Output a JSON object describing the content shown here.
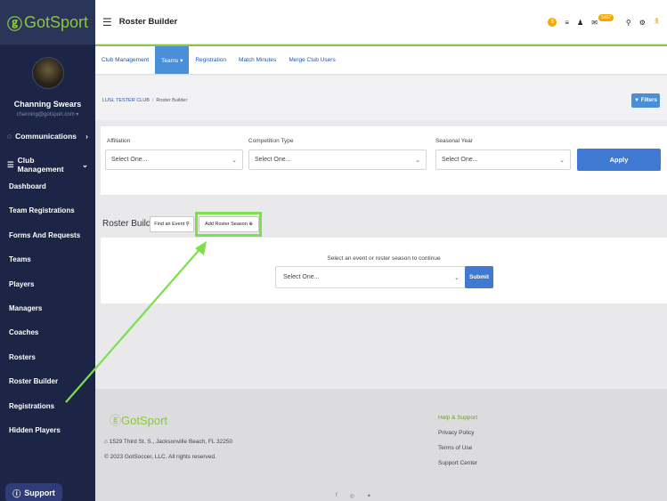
{
  "brand": {
    "name": "GotSport"
  },
  "user": {
    "name": "Channing Swears",
    "email": "channing@gotsport.com ▾"
  },
  "sidebar": {
    "communications": "Communications",
    "club_management": "Club Management",
    "items": [
      {
        "label": "Dashboard"
      },
      {
        "label": "Team Registrations"
      },
      {
        "label": "Forms And Requests"
      },
      {
        "label": "Teams"
      },
      {
        "label": "Players"
      },
      {
        "label": "Managers"
      },
      {
        "label": "Coaches"
      },
      {
        "label": "Rosters"
      },
      {
        "label": "Roster Builder"
      },
      {
        "label": "Registrations"
      },
      {
        "label": "Hidden Players"
      }
    ],
    "support_label": "Support"
  },
  "header": {
    "title": "Roster Builder",
    "notification_count": "5467"
  },
  "tabs": [
    {
      "label": "Club Management"
    },
    {
      "label": "Teams ▾"
    },
    {
      "label": "Registration"
    },
    {
      "label": "Match Minutes"
    },
    {
      "label": "Merge Club Users"
    }
  ],
  "breadcrumb": {
    "club": "LUSL TESTER CLUB",
    "sep": "/",
    "current": "Roster Builder"
  },
  "filters_button": "Filters",
  "filters": {
    "affiliation": {
      "label": "Affiliation",
      "value": "Select One..."
    },
    "competition_type": {
      "label": "Competition Type",
      "value": "Select One..."
    },
    "seasonal_year": {
      "label": "Seasonal Year",
      "value": "Select One..."
    },
    "apply_label": "Apply"
  },
  "roster_builder": {
    "title": "Roster Builder",
    "find_event_label": "Find an Event",
    "add_roster_season_label": "Add Roster Season",
    "prompt": "Select an event or roster season to continue",
    "select_value": "Select One...",
    "submit_label": "Submit"
  },
  "footer": {
    "logo": "GotSport",
    "address": "1529 Third St. S., Jacksonville Beach, FL 32250",
    "copyright": "© 2023 GotSoccer, LLC. All rights reserved.",
    "links": [
      "Help & Support",
      "Privacy Policy",
      "Terms of Use",
      "Support Center"
    ]
  },
  "colors": {
    "sidebar": "#1c2545",
    "accent_green": "#8cc63f",
    "primary_blue": "#3f79d1",
    "highlight_green": "#7be04c"
  }
}
